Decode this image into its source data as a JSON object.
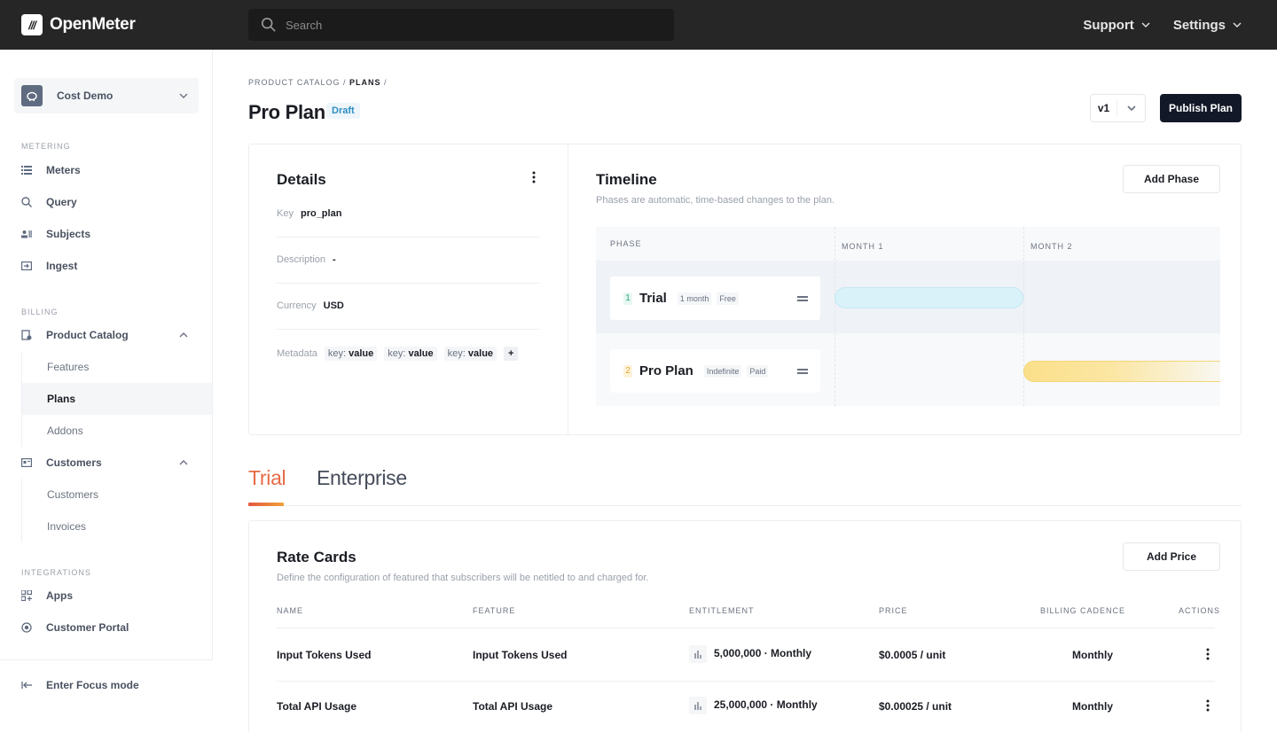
{
  "app": {
    "name": "OpenMeter",
    "logo_glyph": "///"
  },
  "search": {
    "placeholder": "Search"
  },
  "topnav": [
    {
      "label": "Support"
    },
    {
      "label": "Settings"
    }
  ],
  "sidebar": {
    "org": {
      "name": "Cost Demo"
    },
    "sections": {
      "metering": "METERING",
      "billing": "BILLING",
      "integrations": "INTEGRATIONS"
    },
    "metering_items": [
      {
        "label": "Meters",
        "icon": "list-icon"
      },
      {
        "label": "Query",
        "icon": "query-icon"
      },
      {
        "label": "Subjects",
        "icon": "subjects-icon"
      },
      {
        "label": "Ingest",
        "icon": "ingest-icon"
      }
    ],
    "product_catalog": {
      "label": "Product Catalog",
      "children": [
        {
          "label": "Features"
        },
        {
          "label": "Plans",
          "active": true
        },
        {
          "label": "Addons"
        }
      ]
    },
    "customers": {
      "label": "Customers",
      "children": [
        {
          "label": "Customers"
        },
        {
          "label": "Invoices"
        }
      ]
    },
    "integration_items": [
      {
        "label": "Apps",
        "icon": "apps-icon"
      },
      {
        "label": "Customer Portal",
        "icon": "portal-icon"
      }
    ],
    "focus_mode": "Enter Focus mode"
  },
  "page": {
    "breadcrumb": {
      "parent": "PRODUCT CATALOG",
      "current": "PLANS"
    },
    "title": "Pro Plan",
    "status": "Draft",
    "version": "v1",
    "publish_label": "Publish Plan"
  },
  "details": {
    "title": "Details",
    "key_label": "Key",
    "key_value": "pro_plan",
    "description_label": "Description",
    "description_value": "-",
    "currency_label": "Currency",
    "currency_value": "USD",
    "metadata_label": "Metadata",
    "metadata": [
      {
        "k": "key:",
        "v": "value"
      },
      {
        "k": "key:",
        "v": "value"
      },
      {
        "k": "key:",
        "v": "value"
      }
    ],
    "add_metadata": "+"
  },
  "timeline": {
    "title": "Timeline",
    "subtitle": "Phases are automatic, time-based changes to the plan.",
    "add_phase_label": "Add Phase",
    "headers": {
      "phase": "PHASE",
      "month1": "MONTH 1",
      "month2": "MONTH 2"
    },
    "phases": [
      {
        "num": "1",
        "name": "Trial",
        "duration": "1 month",
        "type": "Free",
        "color": "#d6f1f8",
        "num_color": "#2aa37a"
      },
      {
        "num": "2",
        "name": "Pro Plan",
        "duration": "Indefinite",
        "type": "Paid",
        "color": "#fbe08a",
        "num_color": "#e3a830"
      }
    ]
  },
  "tabs": [
    {
      "label": "Trial",
      "active": true
    },
    {
      "label": "Enterprise"
    }
  ],
  "rate_cards": {
    "title": "Rate Cards",
    "subtitle": "Define the configuration of featured that subscribers will be netitled to and charged for.",
    "add_price_label": "Add Price",
    "columns": [
      "NAME",
      "FEATURE",
      "ENTITLEMENT",
      "PRICE",
      "BILLING CADENCE",
      "ACTIONS"
    ],
    "rows": [
      {
        "name": "Input Tokens Used",
        "feature": "Input Tokens Used",
        "entitlement": "5,000,000 · Monthly",
        "price": "$0.0005 / unit",
        "cadence": "Monthly"
      },
      {
        "name": "Total API Usage",
        "feature": "Total API Usage",
        "entitlement": "25,000,000 · Monthly",
        "price": "$0.00025 / unit",
        "cadence": "Monthly"
      }
    ]
  }
}
